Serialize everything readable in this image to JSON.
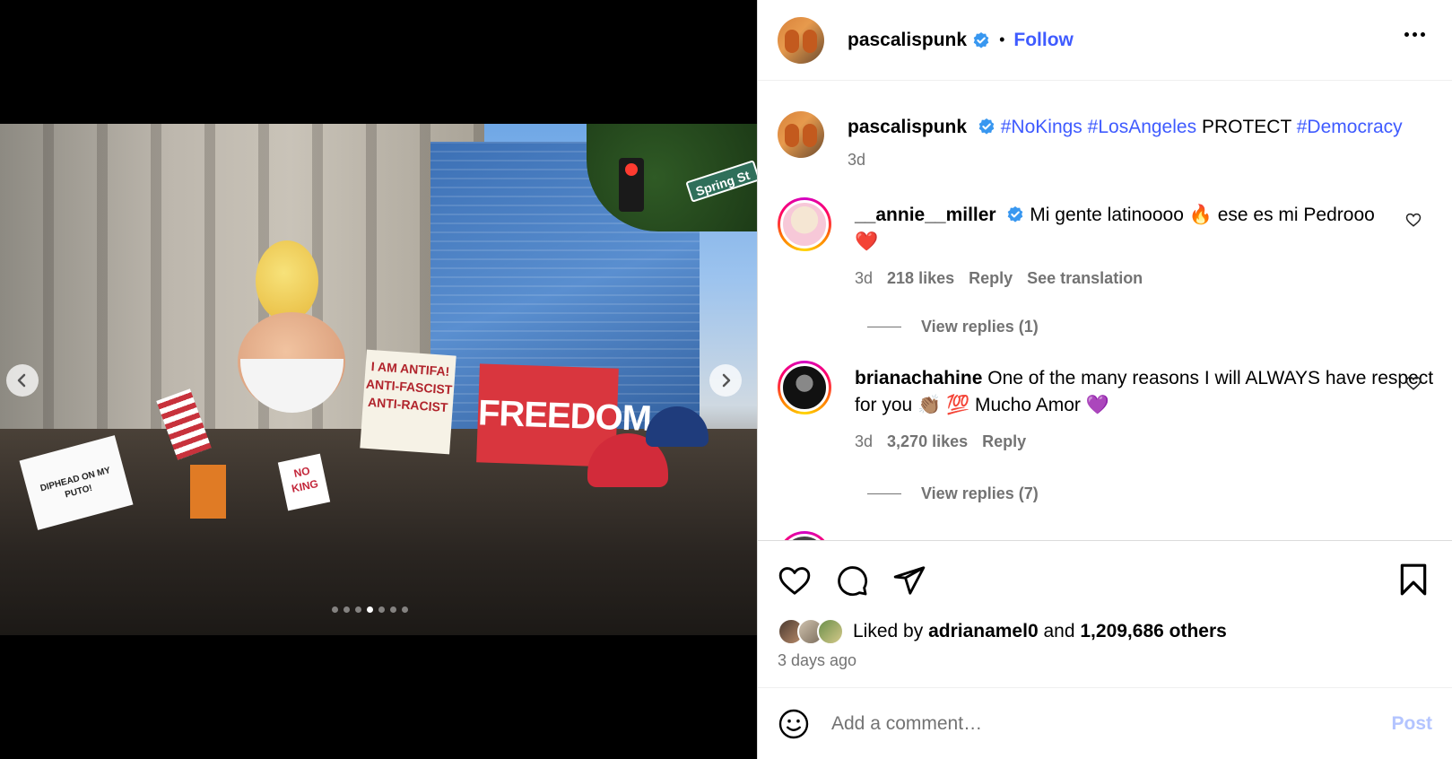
{
  "media": {
    "carousel_dots": 7,
    "active_dot": 3,
    "signs": {
      "freedom": "FREEDOM",
      "antifa": "I AM ANTIFA! ANTI-FASCIST ANTI-RACIST",
      "no_king": "NO KING",
      "pfuto": "DIPHEAD ON MY PUTO!",
      "street": "Spring St"
    }
  },
  "header": {
    "username": "pascalispunk",
    "separator": "•",
    "follow_label": "Follow"
  },
  "caption": {
    "username": "pascalispunk",
    "tag1": "#NoKings",
    "tag2": "#LosAngeles",
    "text": "PROTECT",
    "tag3": "#Democracy",
    "time": "3d"
  },
  "comments": [
    {
      "username": "__annie__miller",
      "text": "Mi gente latinoooo 🔥 ese es mi Pedrooo",
      "text2": "❤️",
      "time": "3d",
      "likes": "218 likes",
      "reply": "Reply",
      "translate": "See translation",
      "view_replies": "View replies (1)"
    },
    {
      "username": "brianachahine",
      "text": "One of the many reasons I will ALWAYS have respect for you 👏🏽 💯 Mucho Amor 💜",
      "time": "3d",
      "likes": "3,270 likes",
      "reply": "Reply",
      "view_replies": "View replies (7)"
    }
  ],
  "likes": {
    "liked_by": "Liked by",
    "user": "adrianamel0",
    "and": "and",
    "others": "1,209,686 others"
  },
  "time_ago": "3 days ago",
  "add_comment": {
    "placeholder": "Add a comment…",
    "post_label": "Post"
  },
  "colors": {
    "link_blue": "#3f5bff",
    "muted": "#737373",
    "post_disabled": "#b3c4ff"
  }
}
